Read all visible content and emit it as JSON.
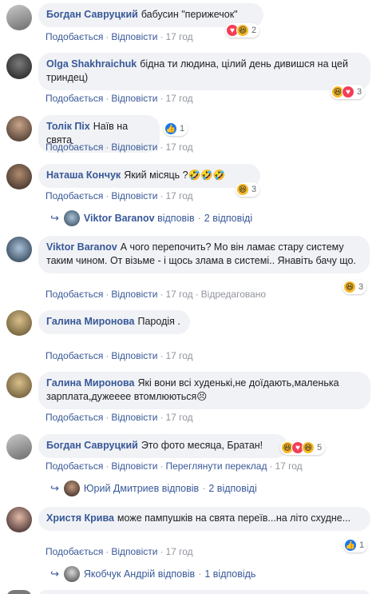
{
  "actions": {
    "like": "Подобається",
    "reply": "Відповісти",
    "translate": "Переглянути переклад",
    "edited": "Відредаговано"
  },
  "comments": [
    {
      "author": "Богдан Савруцкий",
      "text": "бабусин \"перижечок\"",
      "time": "17 год",
      "reaction_count": "2",
      "reactions": [
        "love-icon",
        "haha-icon"
      ]
    },
    {
      "author": "Olga Shakhraichuk",
      "text": "бідна ти людина, цілий день дивишся на цей триндец)",
      "time": "17 год",
      "reaction_count": "3",
      "reactions": [
        "haha-icon",
        "love-icon"
      ]
    },
    {
      "author": "Толік Піх",
      "text": "Наїв на свята",
      "time": "17 год",
      "reaction_count": "1",
      "reactions": [
        "like-icon"
      ]
    },
    {
      "author": "Наташа Кончук",
      "text": "Який місяць ?🤣🤣🤣",
      "time": "17 год",
      "reaction_count": "3",
      "reactions": [
        "haha-icon"
      ],
      "replies": {
        "name": "Viktor Baranov",
        "verb": "відповів",
        "count": "2 відповіді"
      }
    },
    {
      "author": "Viktor Baranov",
      "text": "А чого перепочить? Мо він ламає стару систему таким чином. От візьме - і щось злама в системі.. Янавіть бачу що.",
      "time": "17 год",
      "reaction_count": "3",
      "reactions": [
        "haha-icon"
      ]
    },
    {
      "author": "Галина Миронова",
      "text": "Пародія .",
      "time": "17 год"
    },
    {
      "author": "Галина Миронова",
      "text": "Які вони всі худенькі,не доїдають,маленька зарплата,дужееее втомлюються😣",
      "time": "17 год"
    },
    {
      "author": "Богдан Савруцкий",
      "text": "Это фото месяца, Братан!",
      "time": "17 год",
      "reaction_count": "5",
      "reactions": [
        "haha-icon",
        "love-icon",
        "haha-icon"
      ],
      "replies": {
        "name": "Юрий Дмитриев",
        "verb": "відповів",
        "count": "2 відповіді"
      }
    },
    {
      "author": "Христя Крива",
      "text": "може пампушків на свята переїв...на літо схудне...",
      "time": "17 год",
      "reaction_count": "1",
      "reactions": [
        "like-icon"
      ],
      "replies": {
        "name": "Якобчук Андрій",
        "verb": "відповів",
        "count": "1 відповідь"
      }
    }
  ],
  "colors": {
    "link": "#385898",
    "bubble": "#f0f2f5",
    "like": "#1877f2",
    "love": "#f33e58",
    "haha": "#f7b928",
    "meta": "#90949c"
  }
}
